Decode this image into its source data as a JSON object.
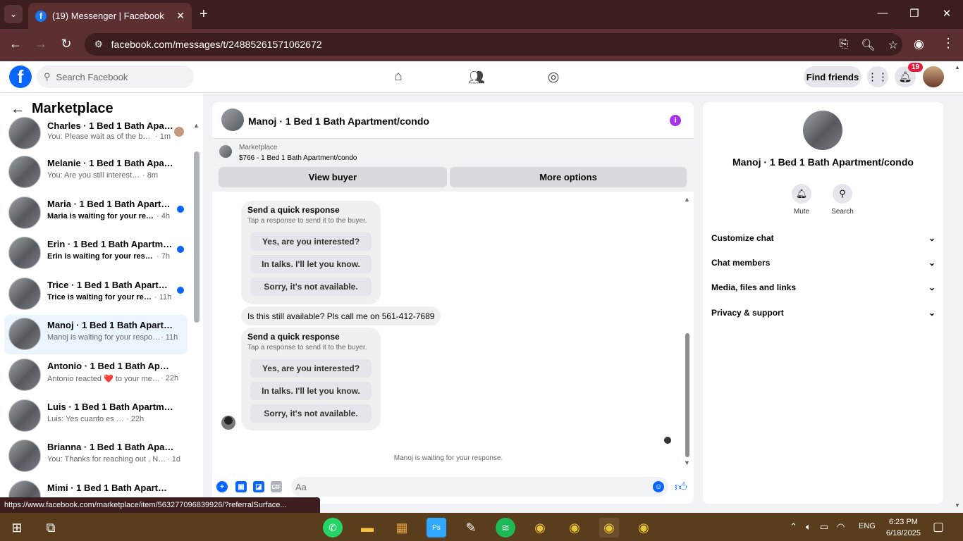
{
  "browser": {
    "tab_title": "(19) Messenger | Facebook",
    "tab_favicon": "f",
    "url": "facebook.com/messages/t/24885261571062672",
    "status_url": "https://www.facebook.com/marketplace/item/563277096839926/?referralSurface..."
  },
  "fb": {
    "search_placeholder": "Search Facebook",
    "find_friends": "Find friends",
    "notif_count": "19",
    "logo": "f"
  },
  "sidebar": {
    "title": "Marketplace",
    "conversations": [
      {
        "name": "Charles · 1 Bed 1 Bath Apartm...",
        "preview": "You: Please wait as of the busy ...",
        "time": "· 1m"
      },
      {
        "name": "Melanie · 1 Bed 1 Bath Apartme...",
        "preview": "You: Are you still interested?",
        "time": "· 8m"
      },
      {
        "name": "Maria · 1 Bed 1 Bath Apartmen...",
        "preview": "Maria is waiting for your respo...",
        "time": "· 4h"
      },
      {
        "name": "Erin · 1 Bed 1 Bath Apartment/...",
        "preview": "Erin is waiting for your response.",
        "time": "· 7h"
      },
      {
        "name": "Trice · 1 Bed 1 Bath Apartment...",
        "preview": "Trice is waiting for your respo...",
        "time": "· 11h"
      },
      {
        "name": "Manoj · 1 Bed 1 Bath Apartment...",
        "preview": "Manoj is waiting for your respons...",
        "time": "· 11h"
      },
      {
        "name": "Antonio · 1 Bed 1 Bath Apartme...",
        "preview": "Antonio reacted ❤️ to your mess...",
        "time": "· 22h"
      },
      {
        "name": "Luis · 1 Bed 1 Bath Apartment/c...",
        "preview": "Luis: Yes cuanto es Todo",
        "time": "· 22h"
      },
      {
        "name": "Brianna · 1 Bed 1 Bath Apartme...",
        "preview": "You: Thanks for reaching out , No i...",
        "time": "· 1d"
      },
      {
        "name": "Mimi · 1 Bed 1 Bath Apartmen...",
        "preview": "",
        "time": ""
      }
    ]
  },
  "chat": {
    "title": "Manoj · 1 Bed 1 Bath Apartment/condo",
    "strip_label": "Marketplace",
    "strip_item": "$766 - 1 Bed 1 Bath Apartment/condo",
    "view_buyer": "View buyer",
    "more_options": "More options",
    "quick_title": "Send a quick response",
    "quick_sub": "Tap a response to send it to the buyer.",
    "quick_1": "Yes, are you interested?",
    "quick_2": "In talks. I'll let you know.",
    "quick_3": "Sorry, it's not available.",
    "message": "Is this still available? Pls call me on 561-412-7689",
    "waiting": "Manoj is waiting for your response.",
    "input_placeholder": "Aa"
  },
  "panel": {
    "title": "Manoj · 1 Bed 1 Bath Apartment/condo",
    "mute": "Mute",
    "search": "Search",
    "rows": [
      "Customize chat",
      "Chat members",
      "Media, files and links",
      "Privacy & support"
    ]
  },
  "taskbar": {
    "lang": "ENG",
    "time": "6:23 PM",
    "date": "6/18/2025"
  }
}
